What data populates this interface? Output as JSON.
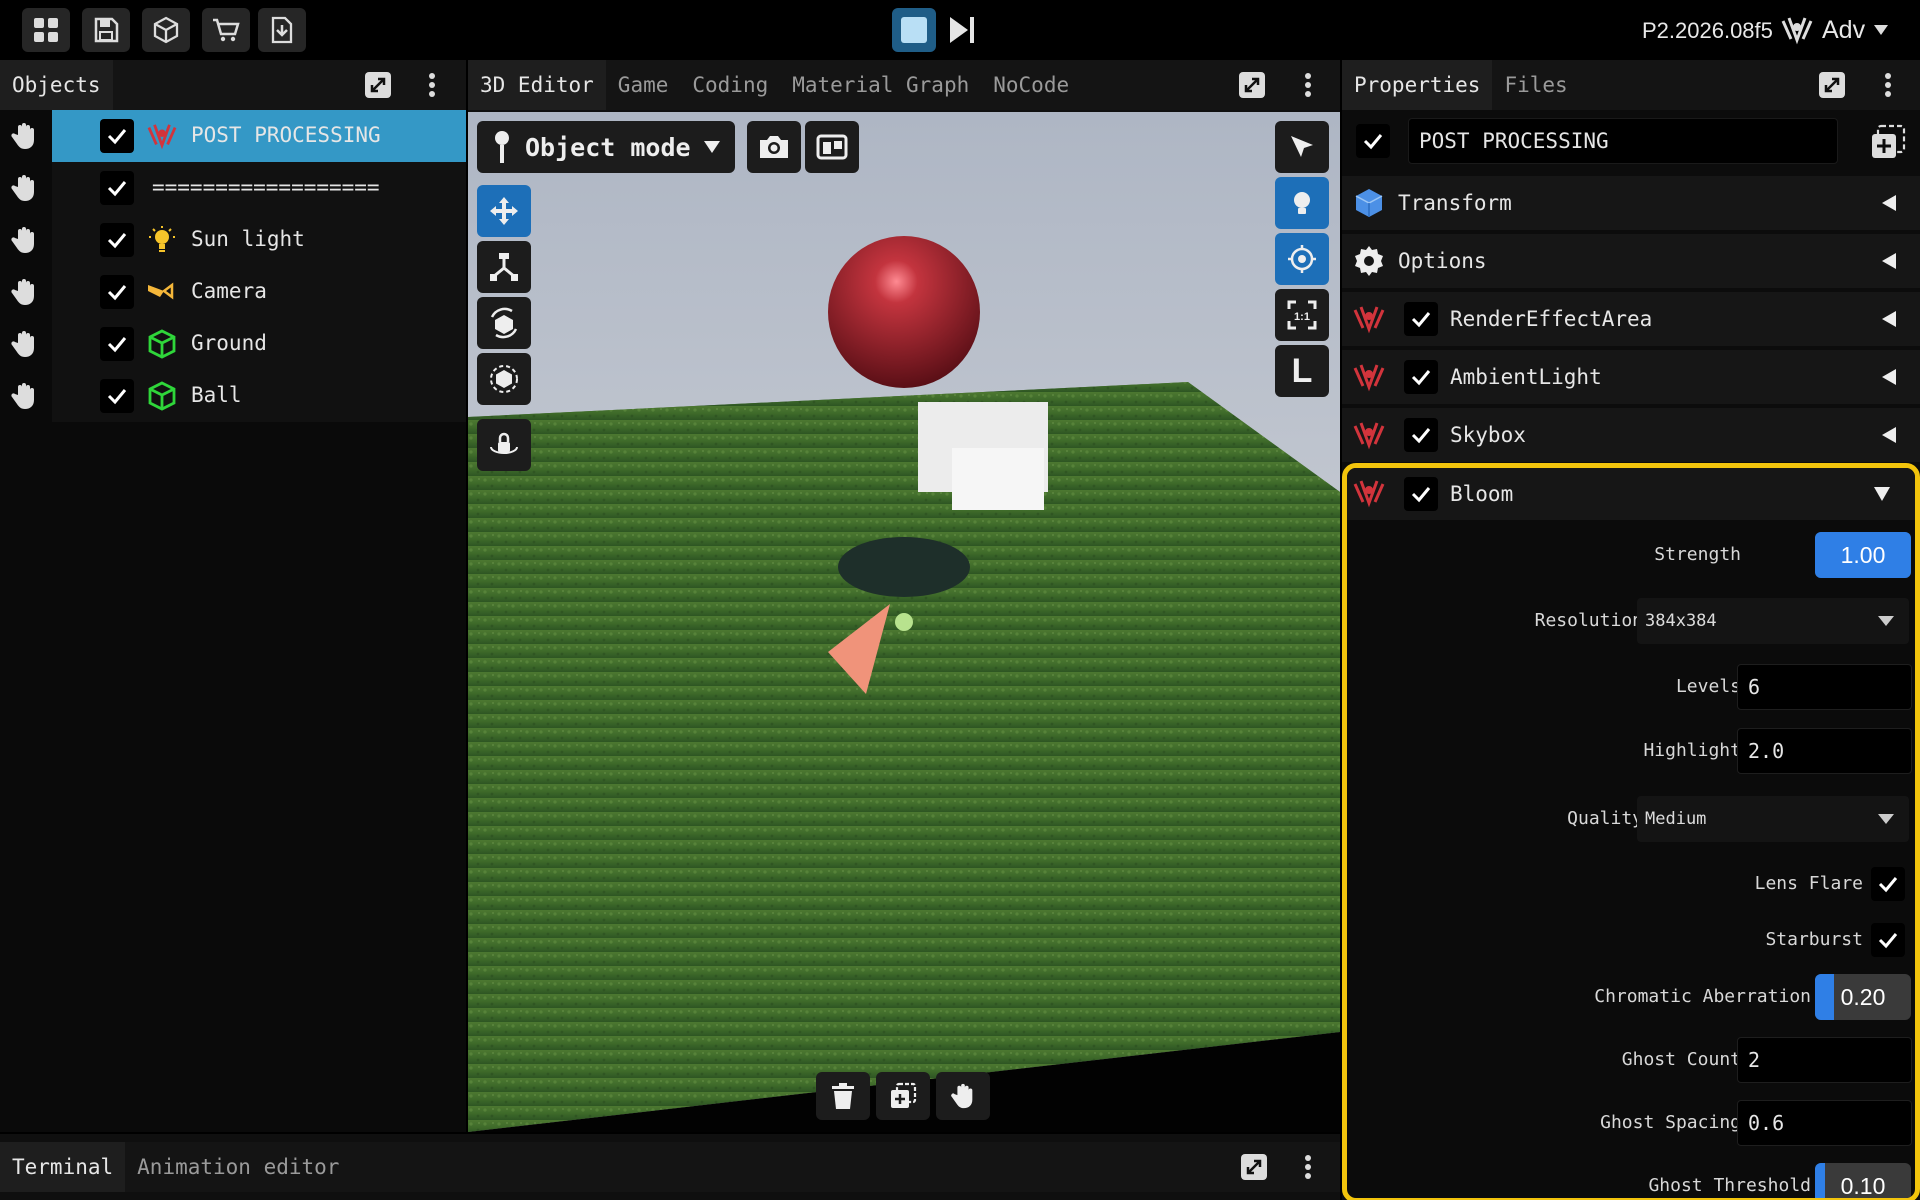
{
  "toolbar": {
    "icons": [
      "grid-icon",
      "save-icon",
      "cube-icon",
      "cart-icon",
      "download-icon"
    ],
    "stop_icon": "stop-icon",
    "step_icon": "step-forward-icon",
    "version": "P2.2026.08f5",
    "user_label": "Adv"
  },
  "objects_panel": {
    "title": "Objects",
    "items": [
      {
        "label": "POST PROCESSING",
        "icon": "post-processing-icon",
        "checked": true,
        "selected": true
      },
      {
        "label": "==================",
        "icon": "",
        "checked": true,
        "selected": false
      },
      {
        "label": "Sun light",
        "icon": "light-bulb-icon",
        "checked": true,
        "selected": false
      },
      {
        "label": "Camera",
        "icon": "camera-icon",
        "checked": true,
        "selected": false
      },
      {
        "label": "Ground",
        "icon": "mesh-icon",
        "checked": true,
        "selected": false
      },
      {
        "label": "Ball",
        "icon": "mesh-icon",
        "checked": true,
        "selected": false
      }
    ]
  },
  "editor_tabs": [
    "3D Editor",
    "Game",
    "Coding",
    "Material Graph",
    "NoCode"
  ],
  "viewport": {
    "mode_label": "Object mode",
    "left_tools": [
      "move-icon",
      "scale-icon",
      "rotate-icon",
      "transform-icon",
      "orbit-lock-icon"
    ],
    "right_tools": [
      "select-pointer-icon",
      "light-toggle-icon",
      "focus-target-icon",
      "fit-view-icon",
      "local-space-icon"
    ],
    "local_label": "L",
    "fit_label": "1:1",
    "bottom_tools": [
      "trash-icon",
      "duplicate-icon",
      "hand-icon"
    ]
  },
  "properties_panel": {
    "tabs": [
      "Properties",
      "Files"
    ],
    "object_name": "POST PROCESSING",
    "sections": [
      {
        "label": "Transform",
        "icon": "transform-cube-icon"
      },
      {
        "label": "Options",
        "icon": "gear-icon"
      },
      {
        "label": "RenderEffectArea",
        "icon": "post-processing-icon",
        "checked": true
      },
      {
        "label": "AmbientLight",
        "icon": "post-processing-icon",
        "checked": true
      },
      {
        "label": "Skybox",
        "icon": "post-processing-icon",
        "checked": true
      }
    ],
    "bloom": {
      "label": "Bloom",
      "checked": true,
      "fields": {
        "strength": {
          "label": "Strength",
          "value": "1.00",
          "fraction": 1.0
        },
        "resolution": {
          "label": "Resolution",
          "value": "384x384"
        },
        "levels": {
          "label": "Levels",
          "value": "6"
        },
        "highlight": {
          "label": "Highlight",
          "value": "2.0"
        },
        "quality": {
          "label": "Quality",
          "value": "Medium"
        },
        "lens_flare": {
          "label": "Lens Flare",
          "checked": true
        },
        "starburst": {
          "label": "Starburst",
          "checked": true
        },
        "chromatic_aberration": {
          "label": "Chromatic Aberration",
          "value": "0.20",
          "fraction": 0.2
        },
        "ghost_count": {
          "label": "Ghost Count",
          "value": "2"
        },
        "ghost_spacing": {
          "label": "Ghost Spacing",
          "value": "0.6"
        },
        "ghost_threshold": {
          "label": "Ghost Threshold",
          "value": "0.10",
          "fraction": 0.1
        }
      }
    }
  },
  "bottom_tabs": [
    "Terminal",
    "Animation editor"
  ],
  "colors": {
    "accent_blue": "#2f7fe6",
    "selection": "#3498c6",
    "highlight_border": "#f2c40c",
    "post_icon_red": "#d2343c",
    "mesh_green": "#2fd63a"
  }
}
